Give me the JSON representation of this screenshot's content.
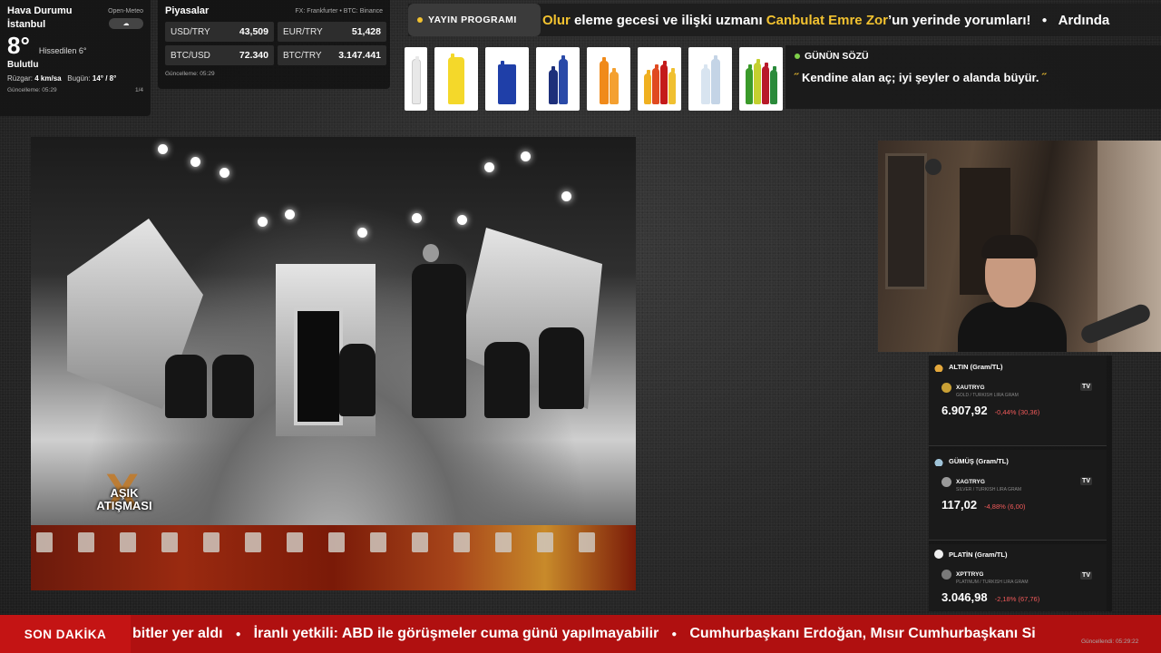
{
  "weather": {
    "title": "Hava Durumu",
    "source": "Open-Meteo",
    "city": "İstanbul",
    "temperature": "8°",
    "feels_like": "Hissedilen 6°",
    "condition": "Bulutlu",
    "wind_label": "Rüzgar:",
    "wind_value": "4 km/sa",
    "today_label": "Bugün:",
    "today_value": "14° / 8°",
    "updated": "Güncelleme: 05:29",
    "page": "1/4"
  },
  "markets": {
    "title": "Piyasalar",
    "source": "FX: Frankfurter • BTC: Binance",
    "items": [
      {
        "pair": "USD/TRY",
        "value": "43,509"
      },
      {
        "pair": "EUR/TRY",
        "value": "51,428"
      },
      {
        "pair": "BTC/USD",
        "value": "72.340"
      },
      {
        "pair": "BTC/TRY",
        "value": "3.147.441"
      }
    ],
    "updated": "Güncelleme: 05:29"
  },
  "schedule": {
    "label": "YAYIN PROGRAMI",
    "text_1": "Olur",
    "text_2": " eleme gecesi ve ilişki uzmanı ",
    "text_3": "Canbulat Emre Zor",
    "text_4": "’un yerinde yorumları!",
    "text_5": "Ardında"
  },
  "quote": {
    "label": "GÜNÜN SÖZÜ",
    "open_mark": "˝",
    "text": "Kendine alan aç; iyi şeyler o alanda büyür.",
    "close_mark": "˝"
  },
  "video": {
    "logo_line1": "AŞIK",
    "logo_line2": "ATIŞMASI"
  },
  "metals": [
    {
      "name": "ALTIN (Gram/TL)",
      "symbol": "XAUTRYG",
      "desc": "GOLD / TURKISH LIRA GRAM",
      "price": "6.907,92",
      "change": "-0,44% (30,36)"
    },
    {
      "name": "GÜMÜŞ (Gram/TL)",
      "symbol": "XAGTRYG",
      "desc": "SILVER / TURKISH LIRA GRAM",
      "price": "117,02",
      "change": "-4,88% (6,00)"
    },
    {
      "name": "PLATİN (Gram/TL)",
      "symbol": "XPTTRYG",
      "desc": "PLATINUM / TURKISH LIRA GRAM",
      "price": "3.046,98",
      "change": "-2,18% (67,76)"
    }
  ],
  "metals_updated": "Güncellendi: 05:29:22",
  "tv_badge": "TV",
  "breaking": {
    "label": "SON DAKİKA",
    "item_1": "bitler yer aldı",
    "item_2": "İranlı yetkili: ABD ile görüşmeler cuma günü yapılmayabilir",
    "item_3": "Cumhurbaşkanı Erdoğan, Mısır Cumhurbaşkanı Si"
  },
  "colors": {
    "accent": "#f2c230",
    "breaking_bg": "#b01010",
    "negative": "#f05a5a",
    "quote_dot": "#7fd04a"
  }
}
